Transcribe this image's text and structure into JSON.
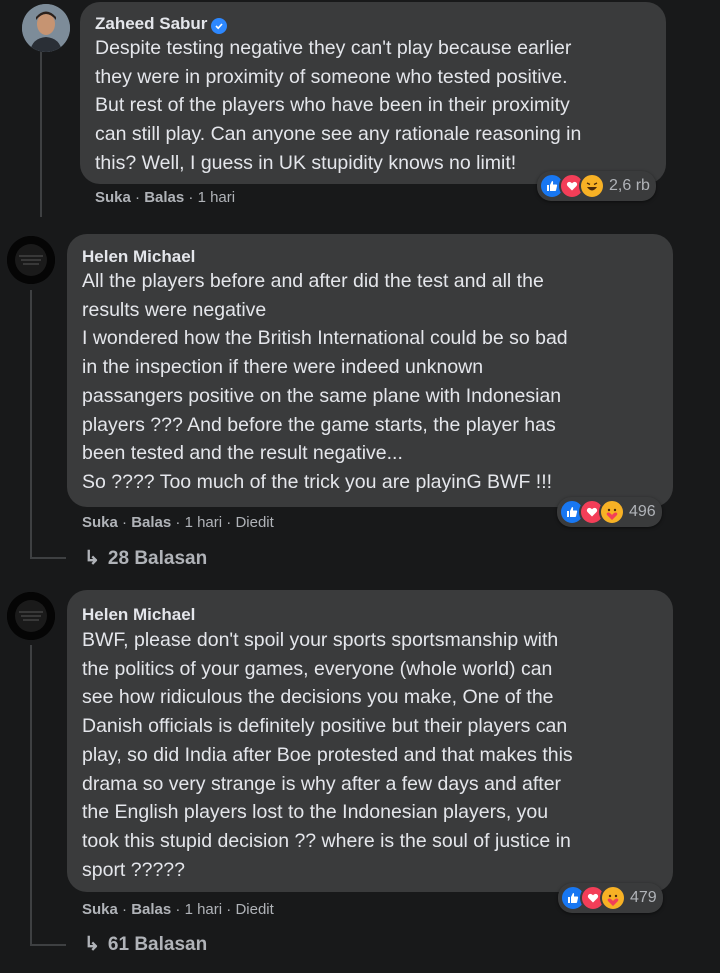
{
  "comments": [
    {
      "author": "Zaheed Sabur",
      "verified": true,
      "text": "Despite testing negative they can't play because earlier\nthey were in proximity of someone who tested positive.\nBut rest of the players who have been in their proximity\ncan still play. Can anyone see any rationale reasoning in\nthis? Well, I guess in UK stupidity knows no limit!",
      "like_label": "Suka",
      "reply_label": "Balas",
      "time": "1 hari",
      "reaction_count": "2,6 rb",
      "reaction_icons": [
        "like-icon",
        "love-icon",
        "haha-icon"
      ]
    },
    {
      "author": "Helen Michael",
      "text": "All the players before and after did the test and all the\nresults were negative\nI wondered how the British International could be so bad\nin the inspection if there were indeed unknown\npassangers positive on the same plane with Indonesian\nplayers ??? And before the game starts, the player has\nbeen tested and the result negative...\nSo ???? Too much of the trick you are playinG BWF !!!",
      "like_label": "Suka",
      "reply_label": "Balas",
      "time": "1 hari",
      "edited": "Diedit",
      "reaction_count": "496",
      "replies_label": "28 Balasan",
      "reaction_icons": [
        "like-icon",
        "love-icon",
        "care-icon"
      ]
    },
    {
      "author": "Helen Michael",
      "text": "BWF, please don't spoil your sports sportsmanship with\nthe politics of your games, everyone (whole world) can\nsee how ridiculous the decisions you make, One of the\nDanish officials is definitely positive but their players can\nplay, so did India after Boe protested and that makes this\ndrama so very strange is why after a few days and after\nthe English players lost to the Indonesian players, you\ntook this stupid decision ?? where is the soul of justice in\nsport ?????",
      "like_label": "Suka",
      "reply_label": "Balas",
      "time": "1 hari",
      "edited": "Diedit",
      "reaction_count": "479",
      "replies_label": "61 Balasan",
      "reaction_icons": [
        "like-icon",
        "love-icon",
        "care-icon"
      ]
    }
  ],
  "separator": "·",
  "reply_arrow": "↳"
}
